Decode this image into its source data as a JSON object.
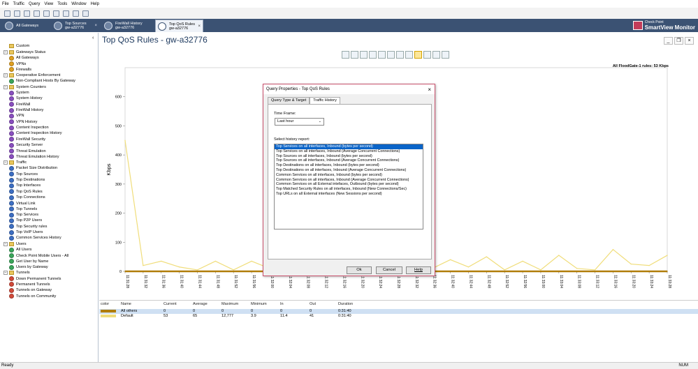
{
  "menu": [
    "File",
    "Traffic",
    "Query",
    "View",
    "Tools",
    "Window",
    "Help"
  ],
  "tabs": [
    {
      "line1": "All Gateways",
      "line2": ""
    },
    {
      "line1": "Top Sources",
      "line2": "gw-a32776"
    },
    {
      "line1": "FireWall History",
      "line2": "gw-a32776"
    },
    {
      "line1": "Top QoS Rules",
      "line2": "gw-a32776"
    }
  ],
  "brand": {
    "line1": "Check Point",
    "line2": "SmartView Monitor"
  },
  "tree": [
    {
      "label": "Custom",
      "level": 1,
      "icon": "folder",
      "color": "#e9c75e"
    },
    {
      "label": "Gateways Status",
      "level": 0,
      "icon": "folder-expanded"
    },
    {
      "label": "All Gateways",
      "level": 1,
      "icon": "dot",
      "color": "#e0a020"
    },
    {
      "label": "VPNs",
      "level": 1,
      "icon": "dot",
      "color": "#e0a020"
    },
    {
      "label": "Firewalls",
      "level": 1,
      "icon": "dot",
      "color": "#e0a020"
    },
    {
      "label": "Cooperative Enforcement",
      "level": 0,
      "icon": "folder-expanded"
    },
    {
      "label": "Non-Compliant Hosts By Gateway",
      "level": 1,
      "icon": "dot",
      "color": "#3aa65a"
    },
    {
      "label": "System Counters",
      "level": 0,
      "icon": "folder-expanded"
    },
    {
      "label": "System",
      "level": 1,
      "icon": "dot",
      "color": "#8a4fc0"
    },
    {
      "label": "System History",
      "level": 1,
      "icon": "dot",
      "color": "#8a4fc0"
    },
    {
      "label": "FireWall",
      "level": 1,
      "icon": "dot",
      "color": "#8a4fc0"
    },
    {
      "label": "FireWall History",
      "level": 1,
      "icon": "dot",
      "color": "#8a4fc0"
    },
    {
      "label": "VPN",
      "level": 1,
      "icon": "dot",
      "color": "#8a4fc0"
    },
    {
      "label": "VPN History",
      "level": 1,
      "icon": "dot",
      "color": "#8a4fc0"
    },
    {
      "label": "Content Inspection",
      "level": 1,
      "icon": "dot",
      "color": "#8a4fc0"
    },
    {
      "label": "Content Inspection History",
      "level": 1,
      "icon": "dot",
      "color": "#8a4fc0"
    },
    {
      "label": "FireWall Security",
      "level": 1,
      "icon": "dot",
      "color": "#8a4fc0"
    },
    {
      "label": "Security Server",
      "level": 1,
      "icon": "dot",
      "color": "#8a4fc0"
    },
    {
      "label": "Threat Emulation",
      "level": 1,
      "icon": "dot",
      "color": "#8a4fc0"
    },
    {
      "label": "Threat Emulation History",
      "level": 1,
      "icon": "dot",
      "color": "#8a4fc0"
    },
    {
      "label": "Traffic",
      "level": 0,
      "icon": "folder-expanded"
    },
    {
      "label": "Packet Size Distribution",
      "level": 1,
      "icon": "dot",
      "color": "#3d6fc4"
    },
    {
      "label": "Top Sources",
      "level": 1,
      "icon": "dot",
      "color": "#3d6fc4"
    },
    {
      "label": "Top Destinations",
      "level": 1,
      "icon": "dot",
      "color": "#3d6fc4"
    },
    {
      "label": "Top Interfaces",
      "level": 1,
      "icon": "dot",
      "color": "#3d6fc4"
    },
    {
      "label": "Top QoS Rules",
      "level": 1,
      "icon": "dot",
      "color": "#3d6fc4"
    },
    {
      "label": "Top Connections",
      "level": 1,
      "icon": "dot",
      "color": "#3d6fc4"
    },
    {
      "label": "Virtual Link",
      "level": 1,
      "icon": "dot",
      "color": "#3d6fc4"
    },
    {
      "label": "Top Tunnels",
      "level": 1,
      "icon": "dot",
      "color": "#3d6fc4"
    },
    {
      "label": "Top Services",
      "level": 1,
      "icon": "dot",
      "color": "#3d6fc4"
    },
    {
      "label": "Top P2P Users",
      "level": 1,
      "icon": "dot",
      "color": "#3d6fc4"
    },
    {
      "label": "Top Security rules",
      "level": 1,
      "icon": "dot",
      "color": "#3d6fc4"
    },
    {
      "label": "Top VoIP Users",
      "level": 1,
      "icon": "dot",
      "color": "#3d6fc4"
    },
    {
      "label": "Common Services History",
      "level": 1,
      "icon": "dot",
      "color": "#3d6fc4"
    },
    {
      "label": "Users",
      "level": 0,
      "icon": "folder-expanded"
    },
    {
      "label": "All Users",
      "level": 1,
      "icon": "dot",
      "color": "#3aa65a"
    },
    {
      "label": "Check Point Mobile Users - All",
      "level": 1,
      "icon": "dot",
      "color": "#3aa65a"
    },
    {
      "label": "Get User by Name",
      "level": 1,
      "icon": "dot",
      "color": "#3aa65a"
    },
    {
      "label": "Users by Gateway",
      "level": 1,
      "icon": "dot",
      "color": "#3aa65a"
    },
    {
      "label": "Tunnels",
      "level": 0,
      "icon": "folder-expanded"
    },
    {
      "label": "Down Permanent Tunnels",
      "level": 1,
      "icon": "dot",
      "color": "#d24a3a"
    },
    {
      "label": "Permanent Tunnels",
      "level": 1,
      "icon": "dot",
      "color": "#d24a3a"
    },
    {
      "label": "Tunnels on Gateway",
      "level": 1,
      "icon": "dot",
      "color": "#d24a3a"
    },
    {
      "label": "Tunnels on Community",
      "level": 1,
      "icon": "dot",
      "color": "#d24a3a"
    }
  ],
  "main": {
    "title": "Top QoS Rules - gw-a32776",
    "summary": "All FloodGate-1 rules: 53 Kbps"
  },
  "chart_data": {
    "type": "line",
    "ylabel": "Kbps",
    "ylim": [
      0,
      700
    ],
    "yticks": [
      0,
      100,
      200,
      300,
      400,
      500,
      600
    ],
    "xticks": [
      "11:31:28",
      "11:31:32",
      "11:31:36",
      "11:31:40",
      "11:31:44",
      "11:31:48",
      "11:31:52",
      "11:31:56",
      "11:32:00",
      "11:32:04",
      "11:32:08",
      "11:32:12",
      "11:32:16",
      "11:32:20",
      "11:32:24",
      "11:32:28",
      "11:32:32",
      "11:32:36",
      "11:32:40",
      "11:32:44",
      "11:32:48",
      "11:32:52",
      "11:32:56",
      "11:33:00",
      "11:33:04",
      "11:33:08",
      "11:33:12",
      "11:33:16",
      "11:33:20",
      "11:33:24",
      "11:33:28"
    ],
    "series": [
      {
        "name": "Default",
        "color": "#f0dd7a",
        "values": [
          450,
          20,
          35,
          15,
          5,
          35,
          5,
          35,
          10,
          20,
          5,
          25,
          10,
          30,
          5,
          25,
          45,
          10,
          40,
          15,
          50,
          5,
          35,
          5,
          55,
          10,
          5,
          75,
          25,
          20,
          55
        ]
      },
      {
        "name": "All others",
        "color": "#b07d0a",
        "values": [
          0,
          0,
          0,
          0,
          0,
          0,
          0,
          0,
          0,
          0,
          0,
          0,
          0,
          0,
          0,
          0,
          0,
          0,
          0,
          0,
          0,
          0,
          0,
          0,
          0,
          0,
          0,
          0,
          0,
          0,
          0
        ]
      }
    ]
  },
  "grid": {
    "headers": [
      "color",
      "Name",
      "Current",
      "Average",
      "Maximum",
      "Minimum",
      "In",
      "Out",
      "Duration"
    ],
    "rows": [
      {
        "color": "#b07d0a",
        "name": "All others",
        "current": "0",
        "average": "0",
        "maximum": "0",
        "minimum": "0",
        "in": "0",
        "out": "0",
        "duration": "0:31:40"
      },
      {
        "color": "#f0dd7a",
        "name": "Default",
        "current": "53",
        "average": "65",
        "maximum": "12,777",
        "minimum": "3.9",
        "in": "11.4",
        "out": "41",
        "duration": "0:31:40"
      }
    ]
  },
  "dialog": {
    "title": "Query Properties - Top QoS Rules",
    "tabs": [
      "Query Type & Target",
      "Traffic History"
    ],
    "time_frame_label": "Time Frame:",
    "time_frame_value": "Last hour",
    "history_label": "Select history report:",
    "history_items": [
      "Top Services on all interfaces, Inbound (bytes per second)",
      "Top Services on all interfaces, Inbound (Average Concurrent Connections)",
      "Top Sources on all interfaces, Inbound (bytes per second)",
      "Top Sources on all interfaces, Inbound (Average Concurrent Connections)",
      "Top Destinations on all interfaces, Inbound (bytes per second)",
      "Top Destinations on all interfaces, Inbound (Average Concurrent Connections)",
      "Common Services on all interfaces, Inbound  (bytes per second)",
      "Common Services on all interfaces, Inbound (Average Concurrent Connections)",
      "Common Services on all External intefaces, Outbound (bytes per second)",
      "Top Matched Security Rules on all interfaces, Inbound (New Connections/Sec)",
      "Top URLs on all External interfaces (New Sessions per second)"
    ],
    "ok": "Ok",
    "cancel": "Cancel",
    "help": "Help"
  },
  "status": {
    "left": "Ready",
    "right": "NUM"
  }
}
